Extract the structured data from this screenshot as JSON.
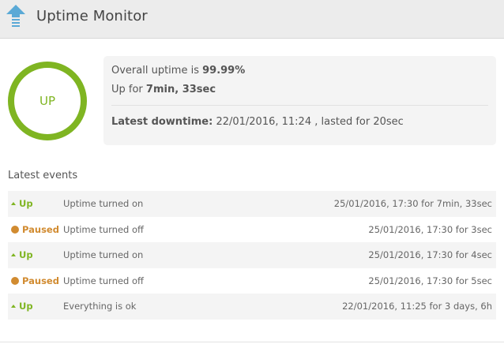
{
  "app": {
    "title": "Uptime Monitor",
    "logo_icon": "arrow-up-icon",
    "accent": "#7fb522",
    "paused_color": "#d18b30"
  },
  "status_ring": {
    "label": "UP",
    "color": "#7fb522"
  },
  "summary": {
    "uptime_prefix": "Overall uptime is ",
    "uptime_value": "99.99%",
    "upfor_prefix": "Up for ",
    "upfor_value": "7min, 33sec",
    "downtime_label": "Latest downtime:",
    "downtime_text": " 22/01/2016, 11:24 , lasted for 20sec"
  },
  "events": {
    "title": "Latest events",
    "rows": [
      {
        "status": "Up",
        "status_type": "up",
        "message": "Uptime turned on",
        "time": "25/01/2016, 17:30 for 7min, 33sec"
      },
      {
        "status": "Paused",
        "status_type": "paused",
        "message": "Uptime turned off",
        "time": "25/01/2016, 17:30 for 3sec"
      },
      {
        "status": "Up",
        "status_type": "up",
        "message": "Uptime turned on",
        "time": "25/01/2016, 17:30 for 4sec"
      },
      {
        "status": "Paused",
        "status_type": "paused",
        "message": "Uptime turned off",
        "time": "25/01/2016, 17:30 for 5sec"
      },
      {
        "status": "Up",
        "status_type": "up",
        "message": "Everything is ok",
        "time": "22/01/2016, 11:25 for 3 days, 6h"
      }
    ]
  }
}
